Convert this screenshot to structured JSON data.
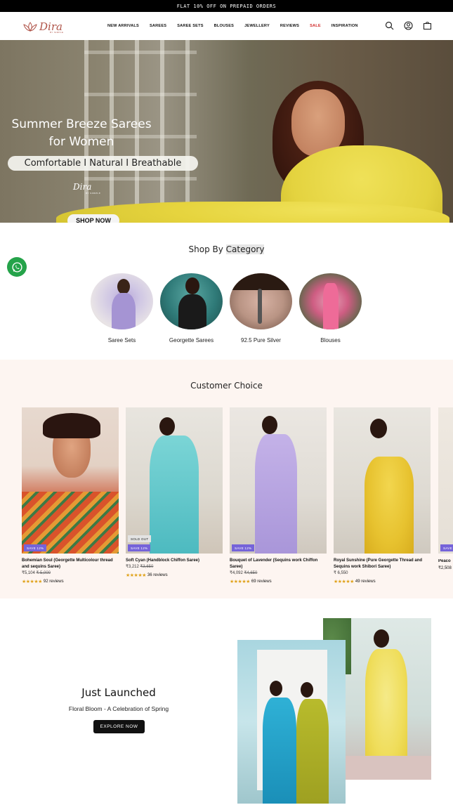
{
  "announcement": "FLAT 10% OFF ON PREPAID ORDERS",
  "brand": {
    "name": "Dira",
    "tagline": "BY SIMPLE"
  },
  "nav": [
    "NEW ARRIVALS",
    "SAREES",
    "SAREE SETS",
    "BLOUSES",
    "JEWELLERY",
    "REVIEWS",
    "SALE",
    "INSPIRATION"
  ],
  "header_icons": [
    "search-icon",
    "account-icon",
    "bag-icon"
  ],
  "hero": {
    "title_line1": "Summer Breeze Sarees",
    "title_line2": "for Women",
    "pill": "Comfortable I Natural I Breathable",
    "cta": "SHOP NOW"
  },
  "shop_by": {
    "title_plain": "Shop By ",
    "title_highlight": "Category"
  },
  "categories": [
    {
      "label": "Saree Sets"
    },
    {
      "label": "Georgette Sarees"
    },
    {
      "label": "92.5 Pure Silver"
    },
    {
      "label": "Blouses"
    }
  ],
  "customer_choice": {
    "title": "Customer Choice",
    "products": [
      {
        "name": "Bohemian Soul (Georgette Multicolour thread and sequins Saree)",
        "price": "₹5,104",
        "compare": "₹ 5,000",
        "badge": "SAVE 12%",
        "sold_out": "",
        "reviews": "92 reviews"
      },
      {
        "name": "Soft Cyan (Handblock Chiffon Saree)",
        "price": "₹3,212",
        "compare": "₹3,650",
        "badge": "SAVE 12%",
        "sold_out": "SOLD OUT",
        "reviews": "36 reviews"
      },
      {
        "name": "Bouquet of Lavender (Sequins work Chiffon Saree)",
        "price": "₹4,092",
        "compare": "₹4,650",
        "badge": "SAVE 12%",
        "sold_out": "",
        "reviews": "69 reviews"
      },
      {
        "name": "Royal Sunshine (Pure Georgette Thread and Sequins work Shibori Saree)",
        "price": "₹ 6,550",
        "compare": "",
        "badge": "",
        "sold_out": "",
        "reviews": "49 reviews"
      }
    ],
    "peek": {
      "name": "Peaco",
      "price": "₹2,508",
      "badge": "SAVE"
    }
  },
  "launch": {
    "title": "Just Launched",
    "subtitle": "Floral Bloom - A Celebration of Spring",
    "cta": "EXPLORE NOW"
  },
  "colors": {
    "sale": "#d12b2b",
    "badge": "#7563d9",
    "whatsapp": "#25a34a",
    "brand": "#b0554a"
  }
}
